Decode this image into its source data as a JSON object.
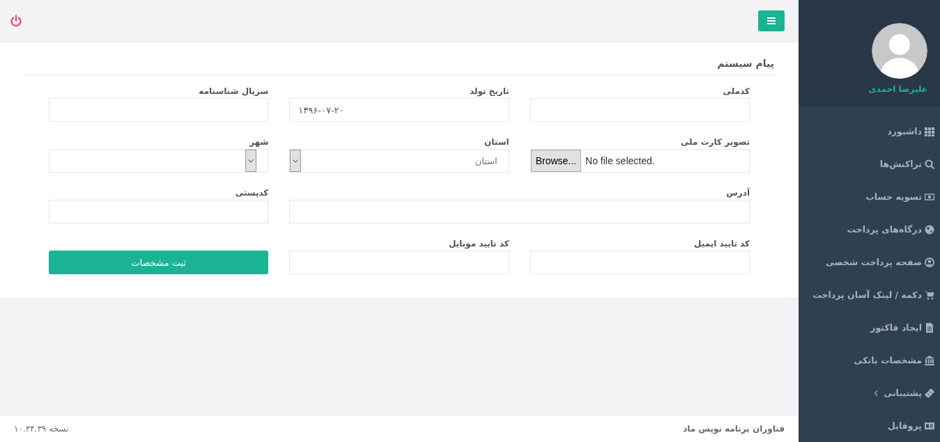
{
  "panel": {
    "title": "پیام سیستم"
  },
  "fields": [
    {
      "kind": "text",
      "label": "کدملی"
    },
    {
      "kind": "date",
      "label": "تاریخ تولد",
      "value": "۱۳۹۶-۰۷-۲۰"
    },
    {
      "kind": "text",
      "label": "سریال شناسنامه"
    },
    {
      "kind": "file",
      "label": "تصویر کارت ملی",
      "button": "Browse...",
      "status": "No file selected."
    },
    {
      "kind": "select",
      "label": "استان",
      "value": "استان"
    },
    {
      "kind": "select",
      "label": "شهر"
    },
    {
      "kind": "wide-text",
      "label": "آدرس"
    },
    {
      "kind": "text",
      "label": "کدپستی"
    },
    {
      "kind": "text",
      "label": "کد تایید ایمیل"
    },
    {
      "kind": "text",
      "label": "کد تایید موبایل"
    },
    {
      "kind": "button",
      "text": "ثبت مشخصات"
    }
  ],
  "footer": {
    "company": "فناوران برنامه نویس ماد",
    "version": "نسخه ۱۰.۳۴.۳۹"
  },
  "user": {
    "name": "علیرضا احمدی"
  },
  "sidebar": {
    "items": [
      {
        "label": "داشبورد",
        "expandable": false
      },
      {
        "label": "تراکنش‌ها",
        "expandable": false
      },
      {
        "label": "تسویه حساب",
        "expandable": false
      },
      {
        "label": "درگاه‌های پرداخت",
        "expandable": false
      },
      {
        "label": "صفحه پرداخت شخصی",
        "expandable": false
      },
      {
        "label": "دکمه / لینک آسان پرداخت",
        "expandable": false
      },
      {
        "label": "ایجاد فاکتور",
        "expandable": false
      },
      {
        "label": "مشخصات بانکی",
        "expandable": false
      },
      {
        "label": "پشتیبانی",
        "expandable": true
      },
      {
        "label": "پروفایل",
        "expandable": false
      }
    ]
  }
}
